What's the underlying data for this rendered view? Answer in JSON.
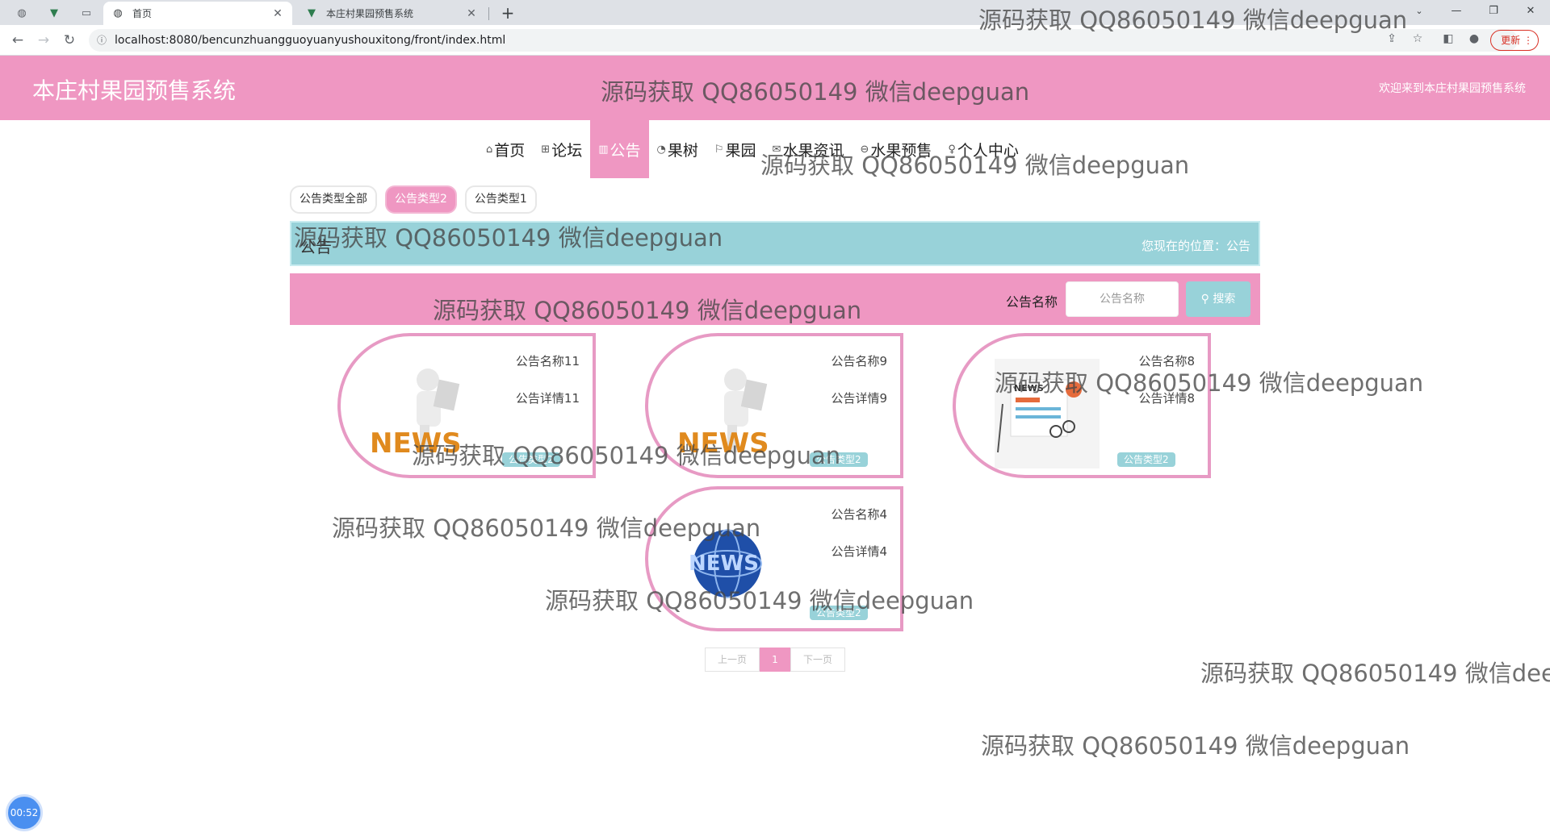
{
  "browser": {
    "tabs": [
      {
        "title": "首页",
        "icon": "globe-icon",
        "active": true
      },
      {
        "title": "本庄村果园预售系统",
        "icon": "vue-logo-icon",
        "active": false
      }
    ],
    "url": "localhost:8080/bencunzhuangguoyuanyushouxitong/front/index.html",
    "update_label": "更新"
  },
  "site": {
    "title": "本庄村果园预售系统",
    "welcome": "欢迎来到本庄村果园预售系统"
  },
  "nav": [
    {
      "label": "首页",
      "icon": "home-icon",
      "active": false
    },
    {
      "label": "论坛",
      "icon": "forum-icon",
      "active": false
    },
    {
      "label": "公告",
      "icon": "notice-icon",
      "active": true
    },
    {
      "label": "果树",
      "icon": "tree-icon",
      "active": false
    },
    {
      "label": "果园",
      "icon": "flag-icon",
      "active": false
    },
    {
      "label": "水果资讯",
      "icon": "mail-icon",
      "active": false
    },
    {
      "label": "水果预售",
      "icon": "presale-icon",
      "active": false
    },
    {
      "label": "个人中心",
      "icon": "user-icon",
      "active": false
    }
  ],
  "type_tabs": [
    {
      "label": "公告类型全部",
      "active": false
    },
    {
      "label": "公告类型2",
      "active": true
    },
    {
      "label": "公告类型1",
      "active": false
    }
  ],
  "breadcrumb": {
    "title": "公告",
    "position": "您现在的位置：公告"
  },
  "search": {
    "label": "公告名称",
    "placeholder": "公告名称",
    "button": "搜索"
  },
  "cards": [
    {
      "name": "公告名称11",
      "detail": "公告详情11",
      "type": "公告类型2",
      "image": "news-figure"
    },
    {
      "name": "公告名称9",
      "detail": "公告详情9",
      "type": "公告类型2",
      "image": "news-figure"
    },
    {
      "name": "公告名称8",
      "detail": "公告详情8",
      "type": "公告类型2",
      "image": "newspaper-illustration"
    },
    {
      "name": "公告名称4",
      "detail": "公告详情4",
      "type": "公告类型2",
      "image": "news-globe"
    }
  ],
  "pagination": {
    "prev": "上一页",
    "current": "1",
    "next": "下一页"
  },
  "timer": "00:52",
  "watermark": "源码获取 QQ86050149 微信deepguan",
  "colors": {
    "primary_pink": "#ef97c2",
    "accent_teal": "#98d2d9",
    "card_border": "#e79ac4"
  }
}
